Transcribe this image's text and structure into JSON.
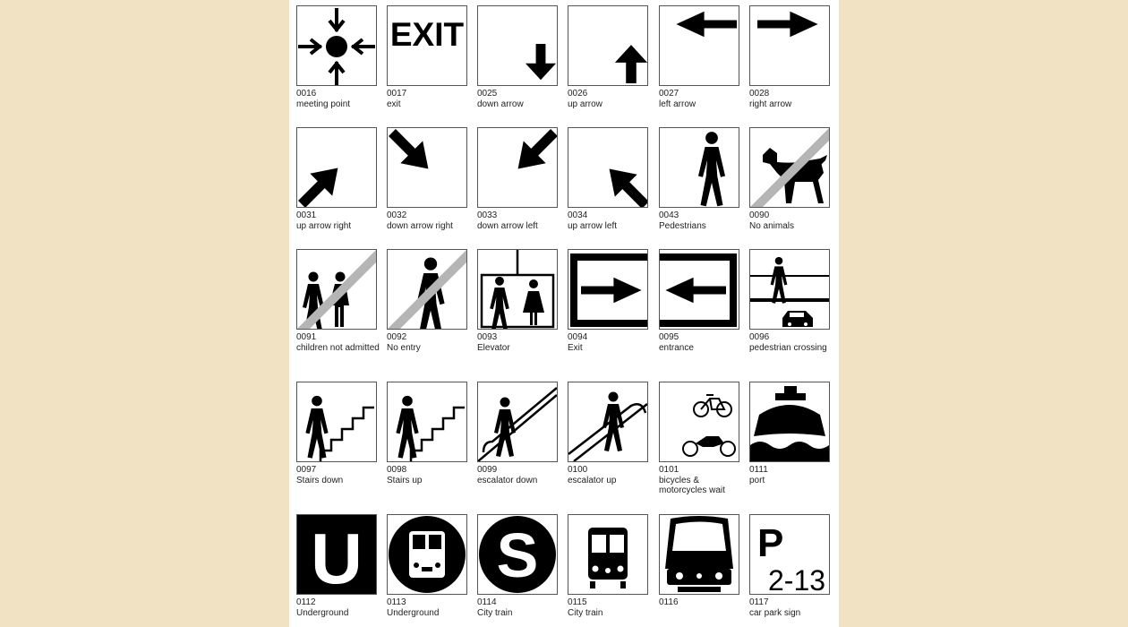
{
  "signs": [
    {
      "code": "0016",
      "label": "meeting point",
      "icon": "meeting-point-icon"
    },
    {
      "code": "0017",
      "label": "exit",
      "icon": "exit-text-icon",
      "text": "EXIT"
    },
    {
      "code": "0025",
      "label": "down arrow",
      "icon": "down-arrow-icon"
    },
    {
      "code": "0026",
      "label": "up arrow",
      "icon": "up-arrow-icon"
    },
    {
      "code": "0027",
      "label": "left arrow",
      "icon": "left-arrow-icon"
    },
    {
      "code": "0028",
      "label": "right arrow",
      "icon": "right-arrow-icon"
    },
    {
      "code": "0031",
      "label": "up arrow right",
      "icon": "up-arrow-right-icon"
    },
    {
      "code": "0032",
      "label": "down arrow right",
      "icon": "down-arrow-right-icon"
    },
    {
      "code": "0033",
      "label": "down arrow left",
      "icon": "down-arrow-left-icon"
    },
    {
      "code": "0034",
      "label": "up arrow left",
      "icon": "up-arrow-left-icon"
    },
    {
      "code": "0043",
      "label": "Pedestrians",
      "icon": "pedestrian-icon"
    },
    {
      "code": "0090",
      "label": "No animals",
      "icon": "no-animals-icon"
    },
    {
      "code": "0091",
      "label": "children not admitted",
      "icon": "children-not-admitted-icon"
    },
    {
      "code": "0092",
      "label": "No entry",
      "icon": "no-entry-icon"
    },
    {
      "code": "0093",
      "label": "Elevator",
      "icon": "elevator-icon"
    },
    {
      "code": "0094",
      "label": "Exit",
      "icon": "exit-arrow-icon"
    },
    {
      "code": "0095",
      "label": "entrance",
      "icon": "entrance-arrow-icon"
    },
    {
      "code": "0096",
      "label": "pedestrian crossing",
      "icon": "pedestrian-crossing-icon"
    },
    {
      "code": "0097",
      "label": "Stairs down",
      "icon": "stairs-down-icon"
    },
    {
      "code": "0098",
      "label": "Stairs up",
      "icon": "stairs-up-icon"
    },
    {
      "code": "0099",
      "label": "escalator down",
      "icon": "escalator-down-icon"
    },
    {
      "code": "0100",
      "label": "escalator up",
      "icon": "escalator-up-icon"
    },
    {
      "code": "0101",
      "label": "bicycles & motorcycles wait",
      "icon": "bicycles-motorcycles-icon"
    },
    {
      "code": "0111",
      "label": "port",
      "icon": "port-ship-icon"
    },
    {
      "code": "0112",
      "label": "Underground",
      "icon": "underground-u-icon",
      "text": "U"
    },
    {
      "code": "0113",
      "label": "Underground",
      "icon": "underground-train-icon"
    },
    {
      "code": "0114",
      "label": "City train",
      "icon": "city-train-s-icon",
      "text": "S"
    },
    {
      "code": "0115",
      "label": "City train",
      "icon": "city-train-icon"
    },
    {
      "code": "0116",
      "label": "",
      "icon": "train-front-icon"
    },
    {
      "code": "0117",
      "label": "car park sign",
      "icon": "car-park-icon",
      "text": "P",
      "subtext": "2-13"
    }
  ]
}
